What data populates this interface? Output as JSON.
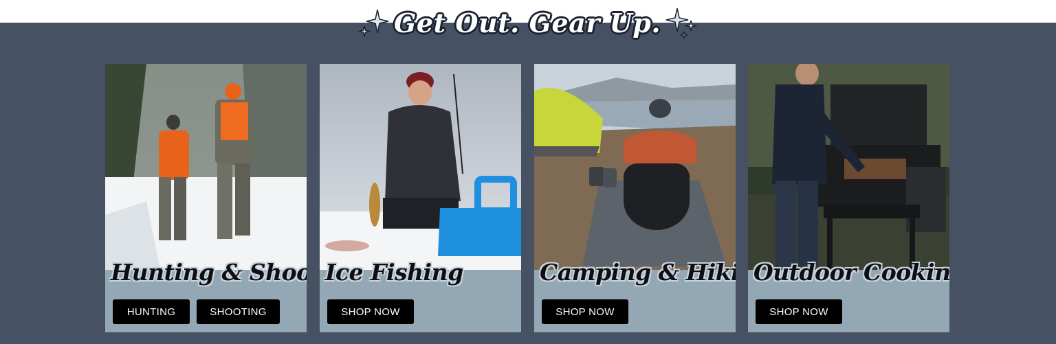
{
  "headline": "Get Out. Gear Up.",
  "colors": {
    "band": "#465263",
    "card_panel": "#93a7b4",
    "button_bg": "#000000",
    "button_text": "#ffffff"
  },
  "cards": [
    {
      "title": "Hunting & Shooting",
      "photo": "hunters-walking-in-snow",
      "buttons": [
        "HUNTING",
        "SHOOTING"
      ]
    },
    {
      "title": "Ice Fishing",
      "photo": "woman-ice-fishing",
      "buttons": [
        "SHOP NOW"
      ]
    },
    {
      "title": "Camping & Hiking",
      "photo": "camper-in-sleeping-bag",
      "buttons": [
        "SHOP NOW"
      ]
    },
    {
      "title": "Outdoor Cooking",
      "photo": "man-at-pellet-grill",
      "buttons": [
        "SHOP NOW"
      ]
    }
  ]
}
